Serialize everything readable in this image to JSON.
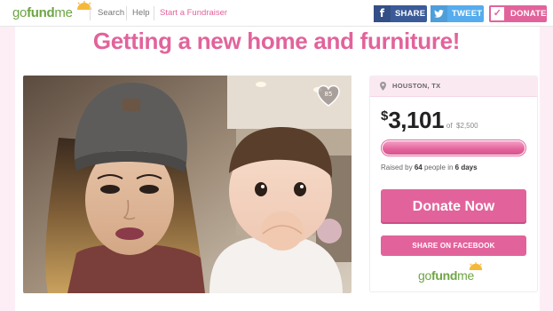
{
  "header": {
    "logo": {
      "go": "go",
      "fund": "fund",
      "me": "me"
    },
    "nav": {
      "search": "Search",
      "help": "Help",
      "start": "Start a Fundraiser"
    },
    "share_buttons": {
      "facebook": {
        "icon": "f",
        "label": "SHARE"
      },
      "twitter": {
        "icon": "twitter-bird-icon",
        "label": "TWEET"
      },
      "donate": {
        "icon": "check-icon",
        "label": "DONATE"
      }
    }
  },
  "campaign": {
    "title": "Getting a new home and furniture!",
    "hearts": "85",
    "location": "HOUSTON, TX",
    "raised": {
      "currency": "$",
      "amount": "3,101",
      "of_label": "of",
      "goal": "$2,500"
    },
    "progress": 1.0,
    "raised_by": {
      "prefix": "Raised by",
      "people": "64",
      "middle": "people in",
      "days": "6 days"
    },
    "donate_label": "Donate Now",
    "share_fb_label": "SHARE ON FACEBOOK"
  },
  "colors": {
    "brand_pink": "#e2639b",
    "brand_green": "#6ea544",
    "facebook_blue": "#3b5b98",
    "twitter_blue": "#55acee",
    "page_background": "#fdeef5"
  }
}
